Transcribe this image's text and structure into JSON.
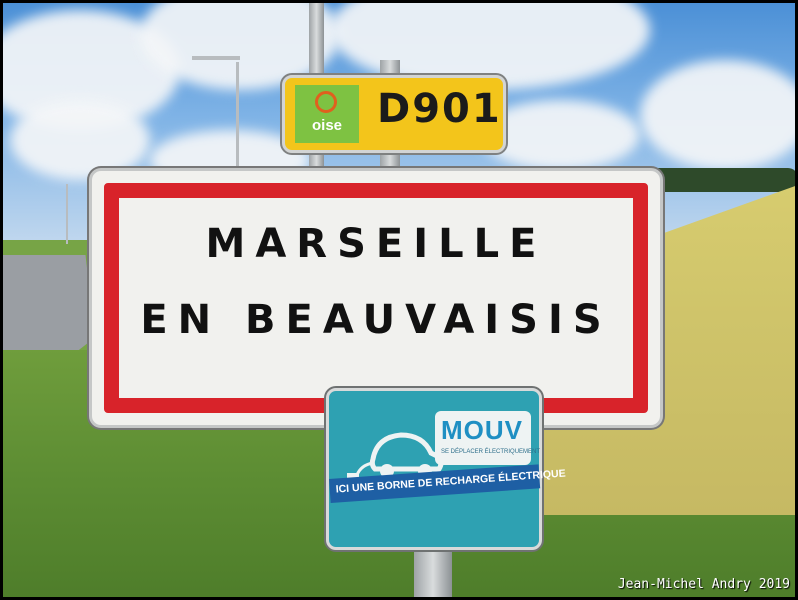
{
  "d_sign": {
    "logo_text": "oise",
    "road_number": "D901",
    "colors": {
      "background": "#f3c51b",
      "logo": "#7ec242"
    }
  },
  "town_sign": {
    "line1": "MARSEILLE",
    "line2": "EN BEAUVAISIS",
    "colors": {
      "border": "#d8232a",
      "background": "#f1f1ee"
    }
  },
  "ev_sign": {
    "brand": "MOUV",
    "brand_sub": "SE DÉPLACER ÉLECTRIQUEMENT",
    "band_text": "ICI UNE BORNE DE RECHARGE ÉLECTRIQUE",
    "icon": "electric-car-plug-icon",
    "colors": {
      "background": "#2ea1b2",
      "band": "#1e5fa4"
    }
  },
  "credit": "Jean-Michel Andry 2019"
}
